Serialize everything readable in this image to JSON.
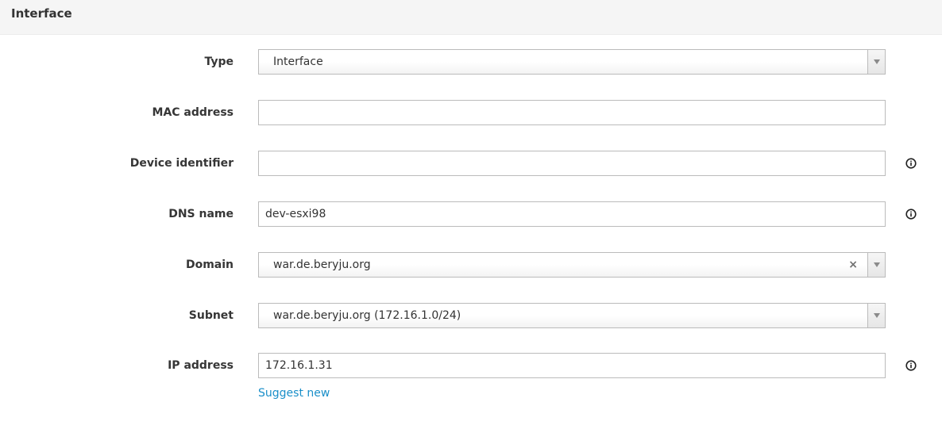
{
  "panel": {
    "title": "Interface"
  },
  "form": {
    "type": {
      "label": "Type",
      "value": "Interface"
    },
    "mac_address": {
      "label": "MAC address",
      "value": ""
    },
    "device_identifier": {
      "label": "Device identifier",
      "value": ""
    },
    "dns_name": {
      "label": "DNS name",
      "value": "dev-esxi98"
    },
    "domain": {
      "label": "Domain",
      "value": "war.de.beryju.org",
      "clear_glyph": "×"
    },
    "subnet": {
      "label": "Subnet",
      "value": "war.de.beryju.org (172.16.1.0/24)"
    },
    "ip_address": {
      "label": "IP address",
      "value": "172.16.1.31",
      "suggest_link": "Suggest new"
    }
  },
  "icons": {
    "info": "info-circle-icon",
    "dropdown": "chevron-down-icon",
    "clear": "clear-icon"
  },
  "colors": {
    "link": "#1a8fc9",
    "border": "#bbbbbb",
    "header_bg": "#f5f5f5"
  }
}
